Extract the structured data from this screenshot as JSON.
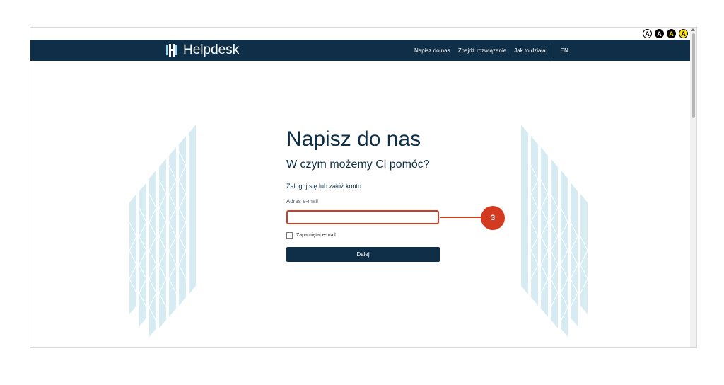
{
  "accessibility": {
    "contrast_buttons": [
      "A",
      "A",
      "A",
      "A"
    ]
  },
  "header": {
    "logo_text": "Helpdesk",
    "nav": [
      "Napisz do nas",
      "Znajdź rozwiązanie",
      "Jak to działa"
    ],
    "language": "EN"
  },
  "main": {
    "title": "Napisz do nas",
    "subtitle": "W czym możemy Ci pomóc?",
    "login_link": "Zaloguj się lub załóż konto",
    "email_label": "Adres e-mail",
    "email_value": "",
    "remember_label": "Zapamiętaj e-mail",
    "remember_checked": false,
    "next_button": "Dalej"
  },
  "annotation": {
    "step_number": "3"
  },
  "colors": {
    "navy": "#0e2f47",
    "highlight": "#d23b1f",
    "decoration": "#c9e6ee"
  }
}
